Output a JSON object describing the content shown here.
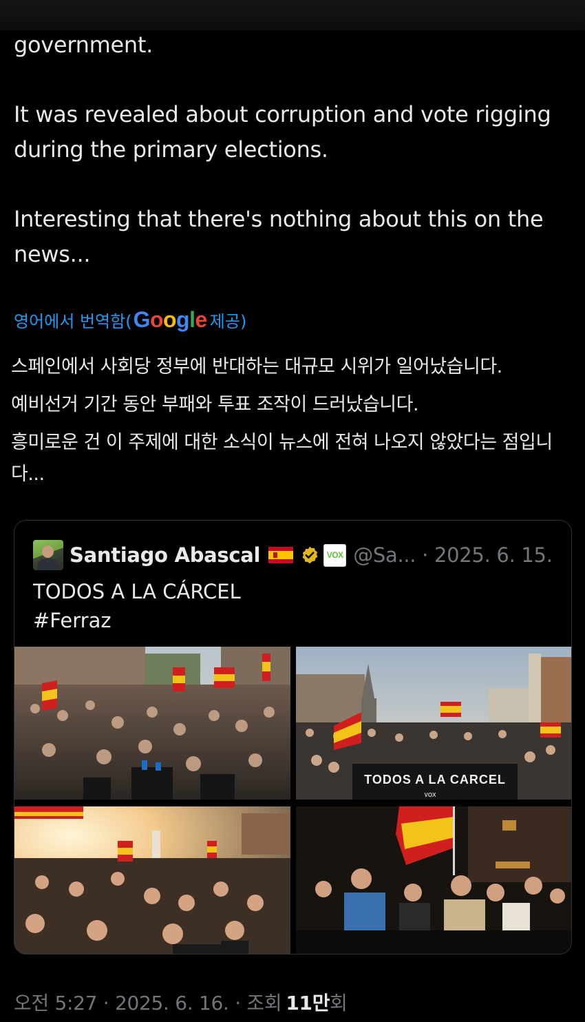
{
  "tweet": {
    "paragraphs": [
      "government.",
      "It was revealed about corruption and vote rigging during the primary elections.",
      "Interesting that there's nothing about this on the news..."
    ]
  },
  "translation_notice": {
    "prefix": "영어에서 번역함(",
    "google_letters": [
      "G",
      "o",
      "o",
      "g",
      "l",
      "e"
    ],
    "suffix": "제공)"
  },
  "translation": {
    "lines": [
      "스페인에서 사회당 정부에 반대하는 대규모 시위가 일어났습니다.",
      "예비선거 기간 동안 부패와 투표 조작이 드러났습니다.",
      "흥미로운 건 이 주제에 대한 소식이 뉴스에 전혀 나오지 않았다는 점입니다..."
    ]
  },
  "quote": {
    "author_name": "Santiago Abascal",
    "flag_icon": "spain-flag-icon",
    "verified_icon": "verified-badge-icon",
    "affiliate_badge": "VOX",
    "handle_and_date": "@Sa... · 2025. 6. 15.",
    "text_lines": [
      "TODOS A LA CÁRCEL",
      "#Ferraz"
    ],
    "photos": [
      {
        "name": "protest-photo-crowd-press",
        "banner": ""
      },
      {
        "name": "protest-photo-banner",
        "banner": "TODOS A LA CARCEL",
        "banner_sub": "VOX"
      },
      {
        "name": "protest-photo-sunset",
        "banner": ""
      },
      {
        "name": "protest-photo-night-leaders",
        "banner": ""
      }
    ]
  },
  "footer": {
    "time_date": "오전 5:27 · 2025. 6. 16. · 조회",
    "views_number": "11만",
    "views_unit": "회"
  },
  "colors": {
    "background": "#000000",
    "text": "#e7e9ea",
    "secondary_text": "#71767b",
    "link_blue": "#1d9bf0",
    "verified_gold": "#e2b719",
    "vox_green": "#5ac036"
  }
}
